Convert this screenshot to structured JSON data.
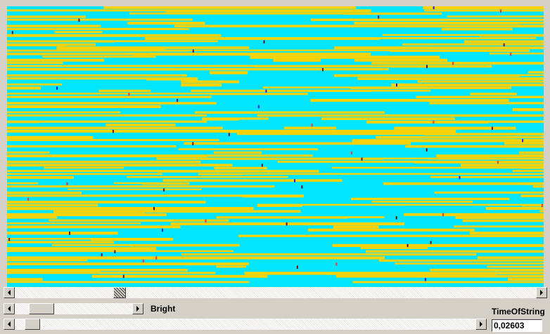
{
  "canvas": {
    "background_color": "#00e6ff",
    "bar_color": "#ffd200",
    "marker_colors": [
      "#1a1aff",
      "#6a0a2a",
      "#800000",
      "#ff3030"
    ]
  },
  "controls": {
    "bright_label": "Bright",
    "time_label": "TimeOfString",
    "time_value": "0,02603"
  },
  "icons": {
    "scroll_left": "left-arrow-icon",
    "scroll_right": "right-arrow-icon"
  }
}
